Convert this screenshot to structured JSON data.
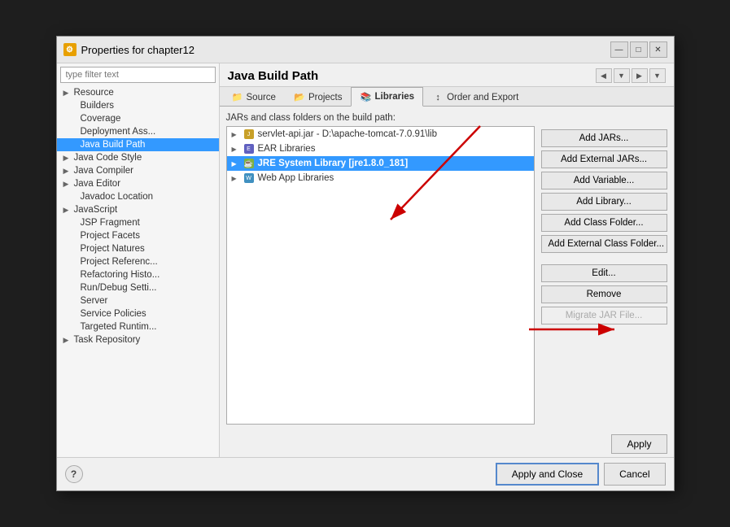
{
  "dialog": {
    "title": "Properties for chapter12",
    "title_icon": "⚙"
  },
  "titlebar_buttons": {
    "minimize": "—",
    "maximize": "□",
    "close": "✕"
  },
  "sidebar": {
    "filter_placeholder": "type filter text",
    "items": [
      {
        "label": "Resource",
        "indent": 1,
        "has_children": true,
        "selected": false
      },
      {
        "label": "Builders",
        "indent": 2,
        "has_children": false,
        "selected": false
      },
      {
        "label": "Coverage",
        "indent": 2,
        "has_children": false,
        "selected": false
      },
      {
        "label": "Deployment Ass...",
        "indent": 2,
        "has_children": false,
        "selected": false
      },
      {
        "label": "Java Build Path",
        "indent": 2,
        "has_children": false,
        "selected": true
      },
      {
        "label": "Java Code Style",
        "indent": 1,
        "has_children": true,
        "selected": false
      },
      {
        "label": "Java Compiler",
        "indent": 1,
        "has_children": true,
        "selected": false
      },
      {
        "label": "Java Editor",
        "indent": 1,
        "has_children": true,
        "selected": false
      },
      {
        "label": "Javadoc Location",
        "indent": 2,
        "has_children": false,
        "selected": false
      },
      {
        "label": "JavaScript",
        "indent": 1,
        "has_children": true,
        "selected": false
      },
      {
        "label": "JSP Fragment",
        "indent": 2,
        "has_children": false,
        "selected": false
      },
      {
        "label": "Project Facets",
        "indent": 2,
        "has_children": false,
        "selected": false
      },
      {
        "label": "Project Natures",
        "indent": 2,
        "has_children": false,
        "selected": false
      },
      {
        "label": "Project Referenc...",
        "indent": 2,
        "has_children": false,
        "selected": false
      },
      {
        "label": "Refactoring Histo...",
        "indent": 2,
        "has_children": false,
        "selected": false
      },
      {
        "label": "Run/Debug Setti...",
        "indent": 2,
        "has_children": false,
        "selected": false
      },
      {
        "label": "Server",
        "indent": 2,
        "has_children": false,
        "selected": false
      },
      {
        "label": "Service Policies",
        "indent": 2,
        "has_children": false,
        "selected": false
      },
      {
        "label": "Targeted Runtim...",
        "indent": 2,
        "has_children": false,
        "selected": false
      },
      {
        "label": "Task Repository",
        "indent": 1,
        "has_children": true,
        "selected": false
      }
    ]
  },
  "content": {
    "title": "Java Build Path",
    "tabs": [
      {
        "label": "Source",
        "icon": "src",
        "active": false
      },
      {
        "label": "Projects",
        "icon": "proj",
        "active": false
      },
      {
        "label": "Libraries",
        "icon": "lib",
        "active": true
      },
      {
        "label": "Order and Export",
        "icon": "ord",
        "active": false
      }
    ],
    "tree_label": "JARs and class folders on the build path:",
    "libraries": [
      {
        "label": "servlet-api.jar - D:\\apache-tomcat-7.0.91\\lib",
        "icon": "jar",
        "expanded": false,
        "selected": false
      },
      {
        "label": "EAR Libraries",
        "icon": "ear",
        "expanded": false,
        "selected": false
      },
      {
        "label": "JRE System Library [jre1.8.0_181]",
        "icon": "jre",
        "expanded": false,
        "selected": true
      },
      {
        "label": "Web App Libraries",
        "icon": "web",
        "expanded": false,
        "selected": false
      }
    ],
    "buttons": [
      {
        "label": "Add JARs...",
        "disabled": false
      },
      {
        "label": "Add External JARs...",
        "disabled": false
      },
      {
        "label": "Add Variable...",
        "disabled": false
      },
      {
        "label": "Add Library...",
        "disabled": false
      },
      {
        "label": "Add Class Folder...",
        "disabled": false
      },
      {
        "label": "Add External Class Folder...",
        "disabled": false
      },
      {
        "label": "Edit...",
        "disabled": false
      },
      {
        "label": "Remove",
        "disabled": false
      },
      {
        "label": "Migrate JAR File...",
        "disabled": true
      }
    ]
  },
  "bottom": {
    "apply_label": "Apply",
    "apply_close_label": "Apply and Close",
    "cancel_label": "Cancel",
    "help_label": "?"
  }
}
